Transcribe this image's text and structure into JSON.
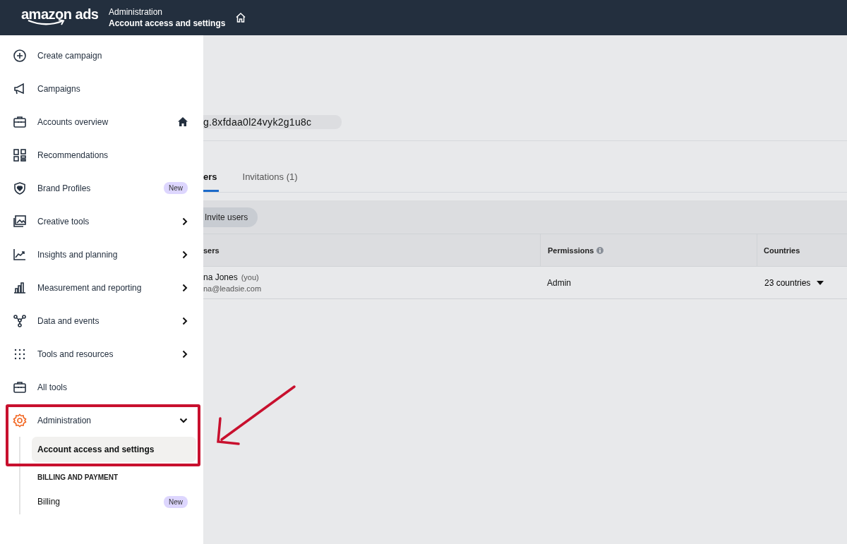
{
  "header": {
    "logo": "amazon ads",
    "parent": "Administration",
    "title": "Account access and settings"
  },
  "main": {
    "account_id": "g.8xfdaa0l24vyk2g1u8c",
    "tabs": [
      {
        "label": "ers",
        "selected": true
      },
      {
        "label": "Invitations (1)",
        "selected": false
      }
    ],
    "invite_button": "Invite users",
    "columns": [
      "sers",
      "Permissions",
      "Countries"
    ],
    "rows": [
      {
        "name": "na Jones",
        "you": "(you)",
        "email": "na@leadsie.com",
        "permission": "Admin",
        "countries": "23 countries"
      }
    ]
  },
  "sidebar": {
    "items": [
      {
        "kind": "link",
        "label": "Create campaign",
        "home": false
      },
      {
        "kind": "link",
        "label": "Campaigns",
        "home": false
      },
      {
        "kind": "link",
        "label": "Accounts overview",
        "home": true
      },
      {
        "kind": "link",
        "label": "Recommendations",
        "home": false
      },
      {
        "kind": "link",
        "label": "Brand Profiles",
        "badge": "New",
        "home": false
      },
      {
        "kind": "submenu",
        "label": "Creative tools",
        "home": false
      },
      {
        "kind": "submenu",
        "label": "Insights and planning",
        "home": false
      },
      {
        "kind": "submenu",
        "label": "Measurement and reporting",
        "home": false
      },
      {
        "kind": "submenu",
        "label": "Data and events",
        "home": false
      },
      {
        "kind": "submenu",
        "label": "Tools and resources",
        "home": false
      },
      {
        "kind": "link",
        "label": "All tools",
        "home": false
      },
      {
        "kind": "group",
        "label": "Administration",
        "expanded": true,
        "home": false,
        "children": [
          {
            "kind": "link",
            "label": "Account access and settings",
            "selected": true
          },
          {
            "kind": "heading",
            "label": "BILLING AND PAYMENT"
          },
          {
            "kind": "link",
            "label": "Billing",
            "badge": "New",
            "selected": false
          }
        ]
      }
    ]
  }
}
